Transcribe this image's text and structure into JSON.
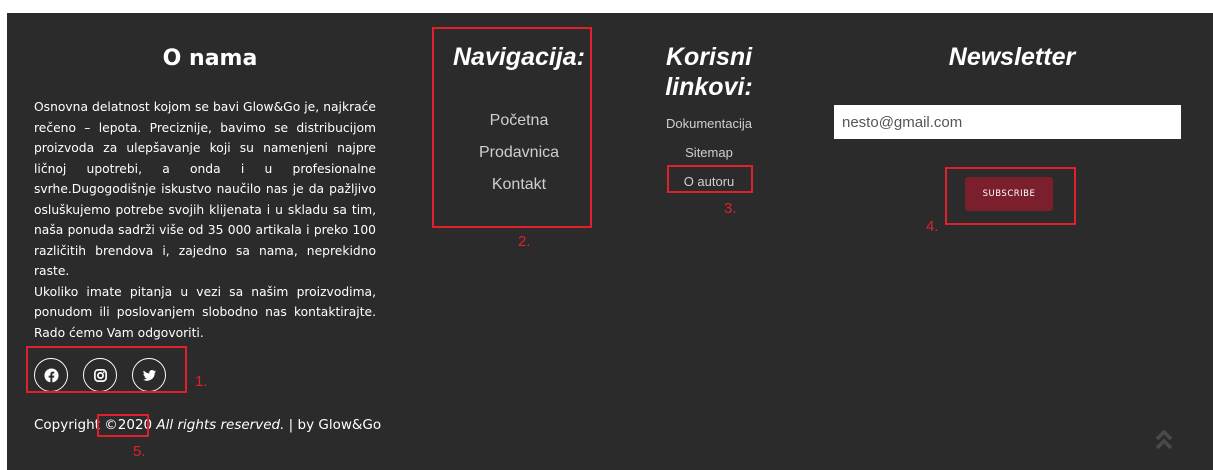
{
  "about": {
    "title": "O nama",
    "paragraph1": "Osnovna delatnost kojom se bavi Glow&Go je, najkraće rečeno – lepota. Preciznije, bavimo se distribucijom proizvoda za ulepšavanje koji su namenjeni najpre ličnoj upotrebi, a onda i u profesionalne svrhe.Dugogodišnje iskustvo naučilo nas je da pažljivo osluškujemo potrebe svojih klijenata i u skladu sa tim, naša ponuda sadrži više od 35 000 artikala i preko 100 različitih brendova i, zajedno sa nama, neprekidno raste.",
    "paragraph2": "Ukoliko imate pitanja u vezi sa našim proizvodima, ponudom ili poslovanjem slobodno nas kontaktirajte. Rado ćemo Vam odgovoriti."
  },
  "social": [
    {
      "icon": "facebook-icon"
    },
    {
      "icon": "instagram-icon"
    },
    {
      "icon": "twitter-icon"
    }
  ],
  "navigation": {
    "title": "Navigacija:",
    "items": [
      "Početna",
      "Prodavnica",
      "Kontakt"
    ]
  },
  "useful_links": {
    "title": "Korisni linkovi:",
    "items": [
      "Dokumentacija",
      "Sitemap",
      "O autoru"
    ]
  },
  "newsletter": {
    "title": "Newsletter",
    "email_value": "nesto@gmail.com",
    "subscribe_label": "SUBSCRIBE"
  },
  "copyright": {
    "prefix": "Copyright ",
    "year": "©2020",
    "rights": " All rights reserved.",
    "suffix": " | by Glow&Go"
  },
  "annotations": [
    "1.",
    "2.",
    "3.",
    "4.",
    "5."
  ],
  "colors": {
    "background": "#2b2b2b",
    "subscribe": "#7a1f2b",
    "annotation": "#e0202d"
  },
  "icons": {
    "scroll_top": "double-chevron-up-icon"
  }
}
